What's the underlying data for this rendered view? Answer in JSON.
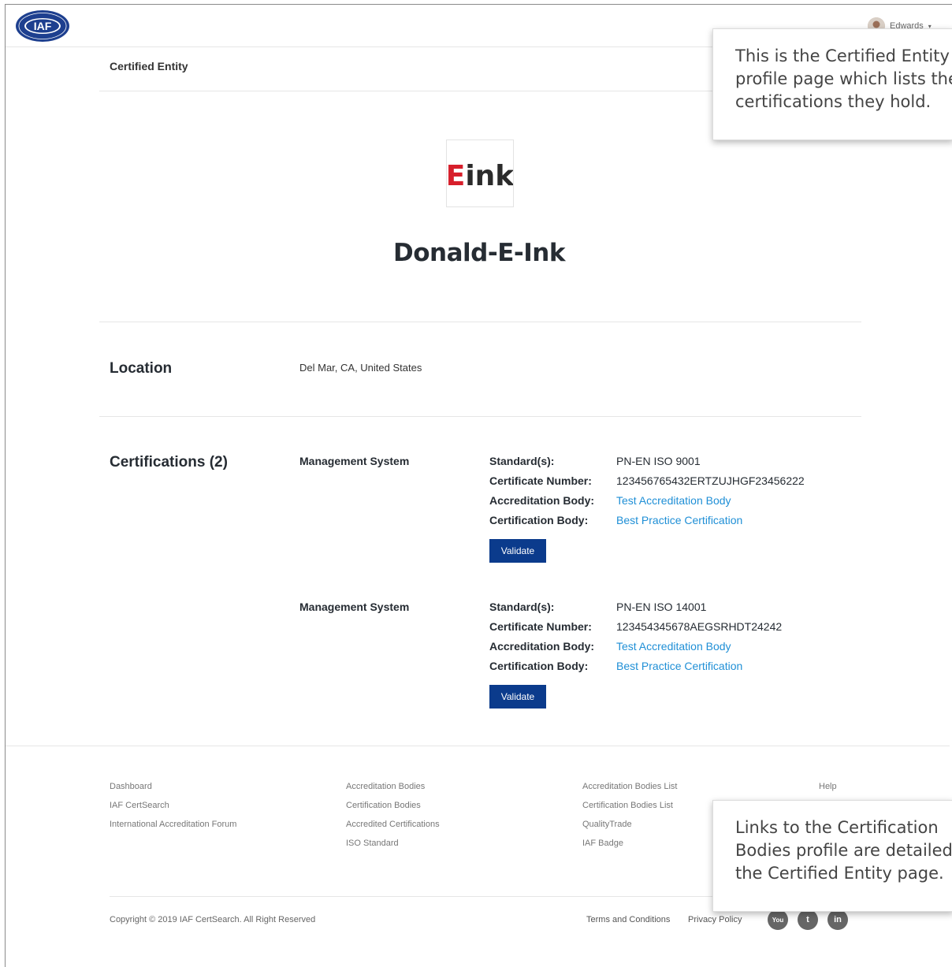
{
  "header": {
    "logo_text": "IAF",
    "user_name": "Edwards",
    "user_caret": "▾"
  },
  "page": {
    "title": "Certified Entity"
  },
  "entity": {
    "logo_text": "Eink",
    "name": "Donald-E-Ink"
  },
  "location": {
    "heading": "Location",
    "value": "Del Mar, CA, United States"
  },
  "certifications": {
    "heading": "Certifications (2)",
    "labels": {
      "standards": "Standard(s):",
      "certificate_number": "Certificate Number:",
      "accreditation_body": "Accreditation Body:",
      "certification_body": "Certification Body:"
    },
    "items": [
      {
        "type": "Management System",
        "standard": "PN-EN ISO 9001",
        "certificate_number": "123456765432ERTZUJHGF23456222",
        "accreditation_body": "Test Accreditation Body",
        "certification_body": "Best Practice Certification",
        "validate_label": "Validate"
      },
      {
        "type": "Management System",
        "standard": "PN-EN ISO 14001",
        "certificate_number": "123454345678AEGSRHDT24242",
        "accreditation_body": "Test Accreditation Body",
        "certification_body": "Best Practice Certification",
        "validate_label": "Validate"
      }
    ]
  },
  "footer": {
    "col1": [
      "Dashboard",
      "IAF CertSearch",
      "International Accreditation Forum"
    ],
    "col2": [
      "Accreditation Bodies",
      "Certification Bodies",
      "Accredited Certifications",
      "ISO Standard"
    ],
    "col3": [
      "Accreditation Bodies List",
      "Certification Bodies List",
      "QualityTrade",
      "IAF Badge"
    ],
    "col4": [
      "Help"
    ],
    "copyright": "Copyright © 2019 IAF CertSearch. All Right Reserved",
    "terms": "Terms and Conditions",
    "privacy": "Privacy Policy",
    "social": {
      "youtube": "You",
      "twitter": "t",
      "linkedin": "in"
    }
  },
  "callouts": {
    "top": [
      "This is the Certified Entity",
      "profile page which lists the",
      "certifications they hold."
    ],
    "bottom": [
      "Links to the Certification",
      "Bodies profile are detailed in",
      "the Certified Entity page."
    ]
  },
  "colors": {
    "primary_button": "#0b3b8c",
    "link": "#1f8fd6",
    "brand_red": "#d71f2b"
  }
}
